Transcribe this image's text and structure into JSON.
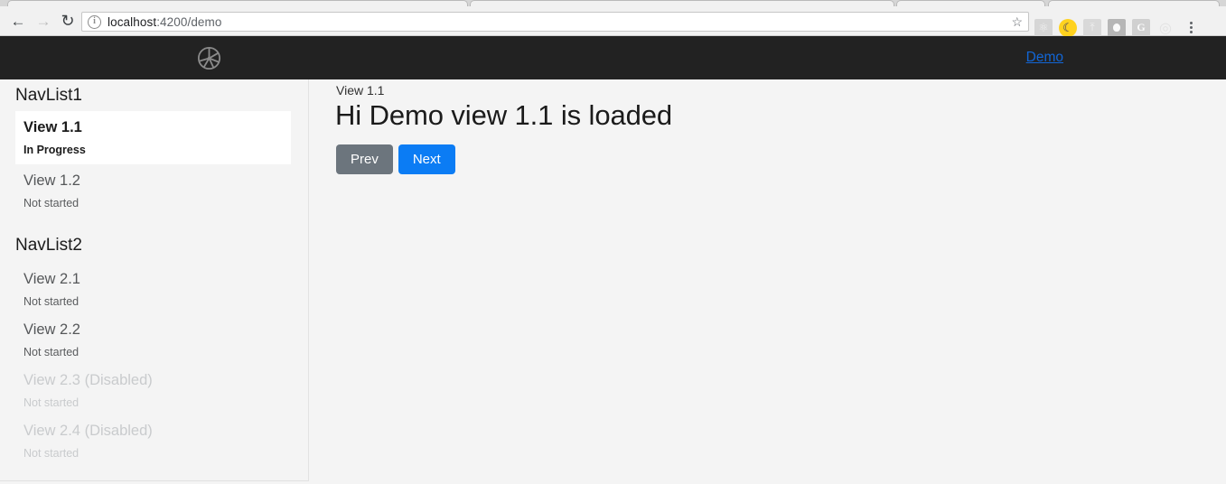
{
  "browser": {
    "back_icon": "back-arrow-icon",
    "forward_icon": "forward-arrow-icon",
    "reload_icon": "reload-icon",
    "url_host": "localhost",
    "url_path": ":4200/demo",
    "url_full": "localhost:4200/demo",
    "site_info_icon": "info-circle-icon",
    "bookmark_icon": "star-icon",
    "extensions": [
      {
        "name": "react-devtools-icon",
        "glyph": "⚛"
      },
      {
        "name": "dark-mode-moon-icon",
        "glyph": "☾"
      },
      {
        "name": "adobe-acrobat-icon",
        "glyph": "⤳"
      },
      {
        "name": "dark-reader-icon",
        "glyph": ""
      },
      {
        "name": "grammarly-g-icon",
        "glyph": "G"
      },
      {
        "name": "target-circle-icon",
        "glyph": "◎"
      }
    ],
    "menu_icon": "three-dot-menu-icon"
  },
  "navbar": {
    "logo_icon": "camera-aperture-icon",
    "link_label": "Demo",
    "link_color": "#1266d6",
    "background": "#222222"
  },
  "sidebar": {
    "groups": [
      {
        "title": "NavList1",
        "items": [
          {
            "label": "View 1.1",
            "status": "In Progress",
            "state": "active"
          },
          {
            "label": "View 1.2",
            "status": "Not started",
            "state": "default"
          }
        ]
      },
      {
        "title": "NavList2",
        "items": [
          {
            "label": "View 2.1",
            "status": "Not started",
            "state": "default"
          },
          {
            "label": "View 2.2",
            "status": "Not started",
            "state": "default"
          },
          {
            "label": "View 2.3 (Disabled)",
            "status": "Not started",
            "state": "disabled"
          },
          {
            "label": "View 2.4 (Disabled)",
            "status": "Not started",
            "state": "disabled"
          }
        ]
      }
    ]
  },
  "main": {
    "breadcrumb": "View 1.1",
    "heading": "Hi Demo view 1.1 is loaded",
    "buttons": {
      "prev_label": "Prev",
      "prev_color": "#6c757d",
      "next_label": "Next",
      "next_color": "#0b7cf4"
    }
  }
}
